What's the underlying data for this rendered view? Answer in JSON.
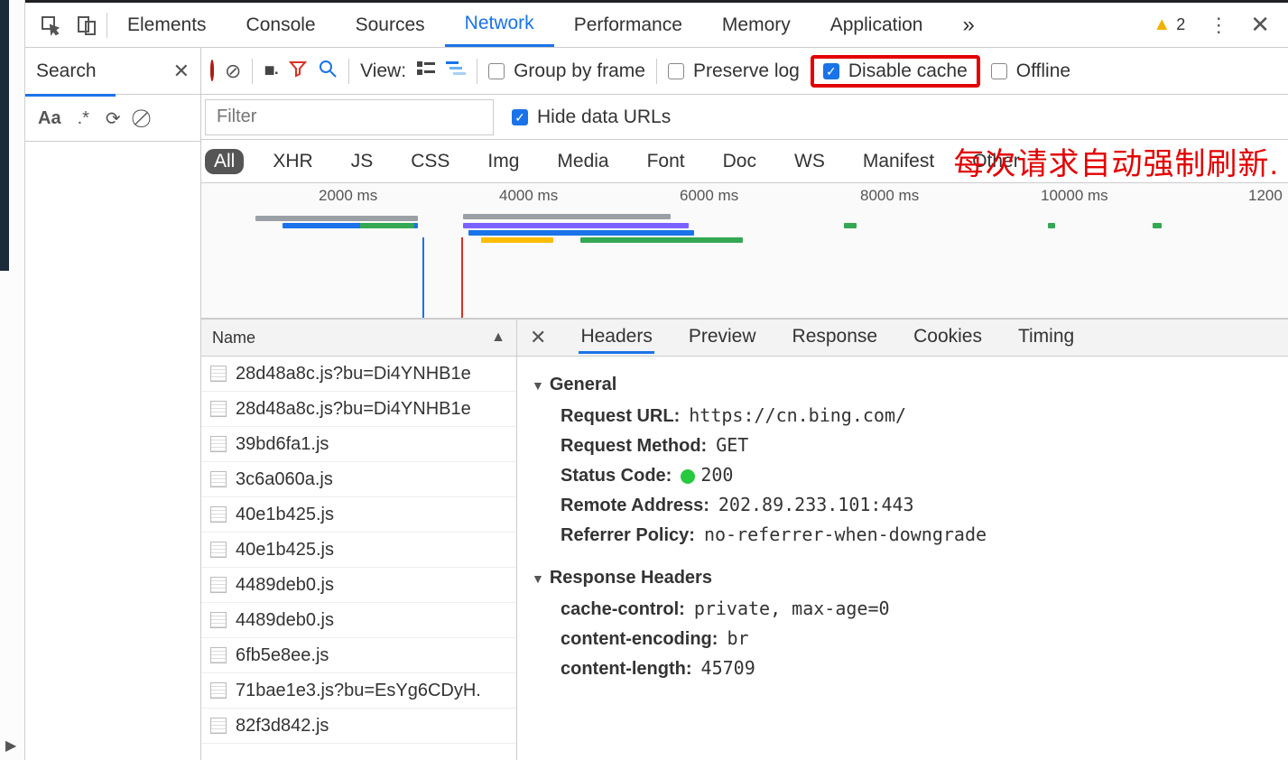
{
  "tabs": {
    "items": [
      "Elements",
      "Console",
      "Sources",
      "Network",
      "Performance",
      "Memory",
      "Application"
    ],
    "selected": "Network",
    "overflow_glyph": "»",
    "warning_count": "2"
  },
  "search_panel": {
    "title": "Search",
    "case_label": "Aa",
    "regex_label": ".*"
  },
  "toolbar": {
    "view_label": "View:",
    "group_label": "Group by frame",
    "preserve_label": "Preserve log",
    "disable_cache_label": "Disable cache",
    "disable_cache_checked": true,
    "offline_label": "Offline"
  },
  "filter_row": {
    "placeholder": "Filter",
    "hide_data_label": "Hide data URLs",
    "hide_data_checked": true
  },
  "annotation": "每次请求自动强制刷新.",
  "type_chips": [
    "All",
    "XHR",
    "JS",
    "CSS",
    "Img",
    "Media",
    "Font",
    "Doc",
    "WS",
    "Manifest",
    "Other"
  ],
  "type_selected": "All",
  "timeline_ticks": [
    "2000 ms",
    "4000 ms",
    "6000 ms",
    "8000 ms",
    "10000 ms",
    "1200"
  ],
  "names_header": "Name",
  "requests": [
    "28d48a8c.js?bu=Di4YNHB1e",
    "28d48a8c.js?bu=Di4YNHB1e",
    "39bd6fa1.js",
    "3c6a060a.js",
    "40e1b425.js",
    "40e1b425.js",
    "4489deb0.js",
    "4489deb0.js",
    "6fb5e8ee.js",
    "71bae1e3.js?bu=EsYg6CDyH.",
    "82f3d842.js"
  ],
  "detail_tabs": [
    "Headers",
    "Preview",
    "Response",
    "Cookies",
    "Timing"
  ],
  "detail_selected": "Headers",
  "sections": {
    "general_title": "General",
    "response_headers_title": "Response Headers"
  },
  "general": {
    "request_url_k": "Request URL:",
    "request_url_v": "https://cn.bing.com/",
    "request_method_k": "Request Method:",
    "request_method_v": "GET",
    "status_k": "Status Code:",
    "status_v": "200",
    "remote_k": "Remote Address:",
    "remote_v": "202.89.233.101:443",
    "referrer_k": "Referrer Policy:",
    "referrer_v": "no-referrer-when-downgrade"
  },
  "resp_headers": {
    "cache_k": "cache-control:",
    "cache_v": "private, max-age=0",
    "enc_k": "content-encoding:",
    "enc_v": "br",
    "len_k": "content-length:",
    "len_v": "45709"
  }
}
